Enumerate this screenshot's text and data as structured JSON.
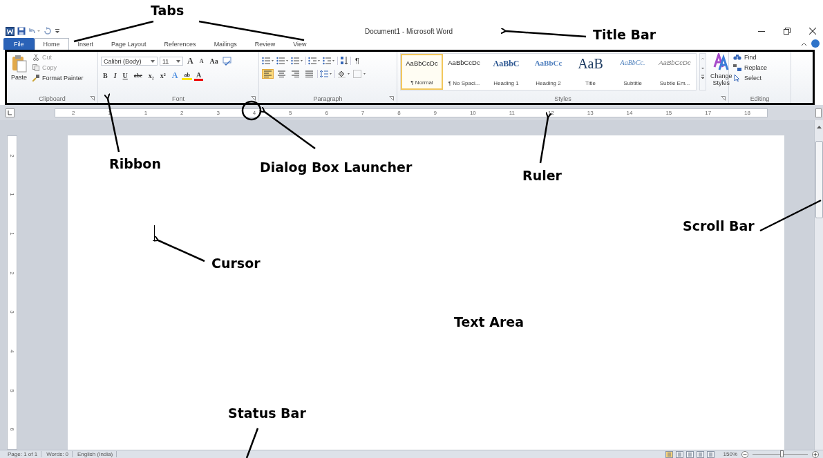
{
  "window": {
    "title": "Document1 - Microsoft Word"
  },
  "tabs": [
    {
      "label": "File",
      "kind": "file",
      "selected": false
    },
    {
      "label": "Home",
      "kind": "tab",
      "selected": true
    },
    {
      "label": "Insert",
      "kind": "tab",
      "selected": false
    },
    {
      "label": "Page Layout",
      "kind": "tab",
      "selected": false
    },
    {
      "label": "References",
      "kind": "tab",
      "selected": false
    },
    {
      "label": "Mailings",
      "kind": "tab",
      "selected": false
    },
    {
      "label": "Review",
      "kind": "tab",
      "selected": false
    },
    {
      "label": "View",
      "kind": "tab",
      "selected": false
    }
  ],
  "clipboard": {
    "paste": "Paste",
    "items": [
      {
        "label": "Cut",
        "disabled": true
      },
      {
        "label": "Copy",
        "disabled": true
      },
      {
        "label": "Format Painter",
        "disabled": false
      }
    ],
    "group": "Clipboard"
  },
  "font": {
    "family": "Calibri (Body)",
    "size": "11",
    "row1": [
      {
        "label": "A",
        "kind": "grow"
      },
      {
        "label": "A",
        "kind": "shrink"
      },
      {
        "label": "Aa",
        "kind": "case"
      }
    ],
    "row2": [
      {
        "label": "B",
        "kind": "bold"
      },
      {
        "label": "I",
        "kind": "italic"
      },
      {
        "label": "U",
        "kind": "underline"
      },
      {
        "label": "abe",
        "kind": "strike"
      },
      {
        "label": "x₂",
        "kind": "plain"
      },
      {
        "label": "x²",
        "kind": "plain"
      },
      {
        "label": "A",
        "kind": "effect"
      },
      {
        "label": "ab",
        "kind": "highlight"
      },
      {
        "label": "A",
        "kind": "color"
      }
    ],
    "group": "Font"
  },
  "paragraph": {
    "pilcrow": "¶",
    "alignments": [
      {
        "selected": true
      },
      {
        "selected": false
      },
      {
        "selected": false
      },
      {
        "selected": false
      }
    ],
    "group": "Paragraph"
  },
  "styles": {
    "items": [
      {
        "preview": "AaBbCcDc",
        "label": "¶ Normal",
        "kind": "normal",
        "selected": true
      },
      {
        "preview": "AaBbCcDc",
        "label": "¶ No Spaci...",
        "kind": "normal",
        "selected": false
      },
      {
        "preview": "AaBbC",
        "label": "Heading 1",
        "kind": "heading1",
        "selected": false
      },
      {
        "preview": "AaBbCc",
        "label": "Heading 2",
        "kind": "heading2",
        "selected": false
      },
      {
        "preview": "AaB",
        "label": "Title",
        "kind": "title",
        "selected": false
      },
      {
        "preview": "AaBbCc.",
        "label": "Subtitle",
        "kind": "subtitle",
        "selected": false
      },
      {
        "preview": "AaBbCcDc",
        "label": "Subtle Em...",
        "kind": "subtle",
        "selected": false
      }
    ],
    "change": "Change Styles",
    "group": "Styles"
  },
  "editing": {
    "items": [
      {
        "label": "Find",
        "kind": "find"
      },
      {
        "label": "Replace",
        "kind": "replace"
      },
      {
        "label": "Select",
        "kind": "select"
      }
    ],
    "group": "Editing"
  },
  "ruler": {
    "numbers": [
      "2",
      "1",
      "1",
      "2",
      "3",
      "4",
      "5",
      "6",
      "7",
      "8",
      "9",
      "10",
      "11",
      "12",
      "13",
      "14",
      "15",
      "17",
      "18"
    ]
  },
  "vertical_ruler": {
    "numbers": [
      "2",
      "1",
      "1",
      "2",
      "3",
      "4",
      "5",
      "6"
    ]
  },
  "status_bar": {
    "items": [
      "Page: 1 of 1",
      "Words: 0",
      "English (India)"
    ],
    "zoom": "150%",
    "zoom_level": {
      "level": 0.53
    },
    "views": [
      {
        "selected": true
      },
      {
        "selected": false
      },
      {
        "selected": false
      },
      {
        "selected": false
      },
      {
        "selected": false
      }
    ]
  },
  "annotations": [
    {
      "label": "Tabs"
    },
    {
      "label": "Title Bar"
    },
    {
      "label": "Ribbon"
    },
    {
      "label": "Dialog Box Launcher"
    },
    {
      "label": "Ruler"
    },
    {
      "label": "Scroll Bar"
    },
    {
      "label": "Cursor"
    },
    {
      "label": "Text Area"
    },
    {
      "label": "Status Bar"
    }
  ]
}
